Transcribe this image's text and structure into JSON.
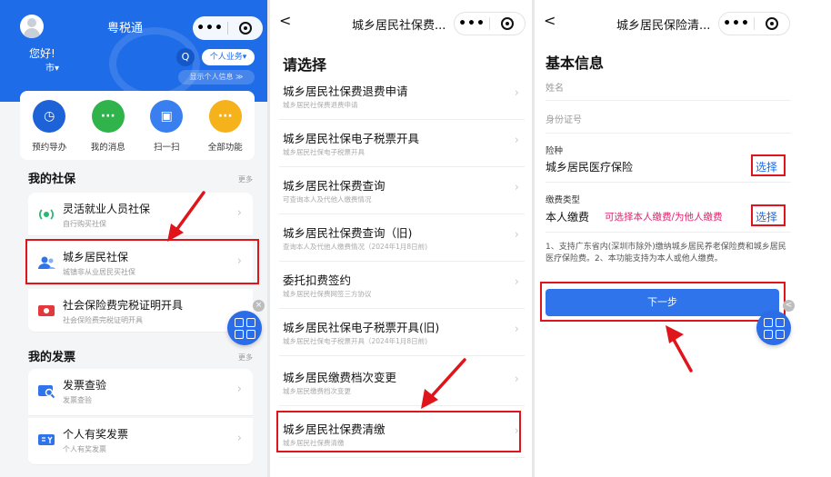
{
  "colors": {
    "brand_blue": "#1e6ce8",
    "highlight_red": "#e0151b",
    "hint_pink": "#e0226e"
  },
  "panel1": {
    "app_title": "粤税通",
    "greeting": "您好!",
    "city": "市▾",
    "business_pill": "个人业务▾",
    "show_info": "显示个人信息 ≫",
    "quick_actions": [
      {
        "label": "预约导办",
        "icon": "clock-icon",
        "color": "#1e62d8",
        "glyph": "◷"
      },
      {
        "label": "我的消息",
        "icon": "message-icon",
        "color": "#2fb34a",
        "glyph": "···"
      },
      {
        "label": "扫一扫",
        "icon": "scan-icon",
        "color": "#3a7ff0",
        "glyph": "▣"
      },
      {
        "label": "全部功能",
        "icon": "more-icon",
        "color": "#f5b21b",
        "glyph": "···"
      }
    ],
    "social_title": "我的社保",
    "more_label": "更多",
    "social_items": [
      {
        "title": "灵活就业人员社保",
        "sub": "自行购买社保",
        "icon": "radio-icon"
      },
      {
        "title": "城乡居民社保",
        "sub": "城镇非从业居民买社保",
        "icon": "people-icon"
      },
      {
        "title": "社会保险费完税证明开具",
        "sub": "社会保险费完税证明开具",
        "icon": "certificate-icon"
      }
    ],
    "invoice_title": "我的发票",
    "invoice_items": [
      {
        "title": "发票查验",
        "sub": "发票查验",
        "icon": "invoice-check-icon"
      },
      {
        "title": "个人有奖发票",
        "sub": "个人有奖发票",
        "icon": "reward-invoice-icon"
      }
    ]
  },
  "panel2": {
    "nav_title": "城乡居民社保费...",
    "heading": "请选择",
    "items": [
      {
        "title": "城乡居民社保费退费申请",
        "sub": "城乡居民社保费退费申请"
      },
      {
        "title": "城乡居民社保电子税票开具",
        "sub": "城乡居民社保电子税票开具"
      },
      {
        "title": "城乡居民社保费查询",
        "sub": "可查询本人及代他人缴费情况"
      },
      {
        "title": "城乡居民社保费查询（旧)",
        "sub": "查询本人及代他人缴费情况（2024年1月8日前)"
      },
      {
        "title": "委托扣费签约",
        "sub": "城乡居民社保费网签三方协议"
      },
      {
        "title": "城乡居民社保电子税票开具(旧)",
        "sub": "城乡居民社保电子税票开具（2024年1月8日前)"
      },
      {
        "title": "城乡居民缴费档次变更",
        "sub": "城乡居民缴费档次变更"
      },
      {
        "title": "城乡居民社保费清缴",
        "sub": "城乡居民社保费清缴"
      }
    ]
  },
  "panel3": {
    "nav_title": "城乡居民保险清...",
    "heading": "基本信息",
    "name_label": "姓名",
    "id_label": "身份证号",
    "insurance_label": "险种",
    "insurance_value": "城乡居民医疗保险",
    "select_label": "选择",
    "payment_label": "缴费类型",
    "payment_value": "本人缴费",
    "payment_hint": "可选择本人缴费/为他人缴费",
    "notes": "1、支持广东省内(深圳市除外)缴纳城乡居民养老保险费和城乡居民医疗保险费。2、本功能支持为本人或他人缴费。",
    "next_button": "下一步"
  },
  "capsule": {
    "dots": "•••"
  },
  "glyphs": {
    "back": "<",
    "chevron": "›",
    "close": "×",
    "search": "Q"
  }
}
